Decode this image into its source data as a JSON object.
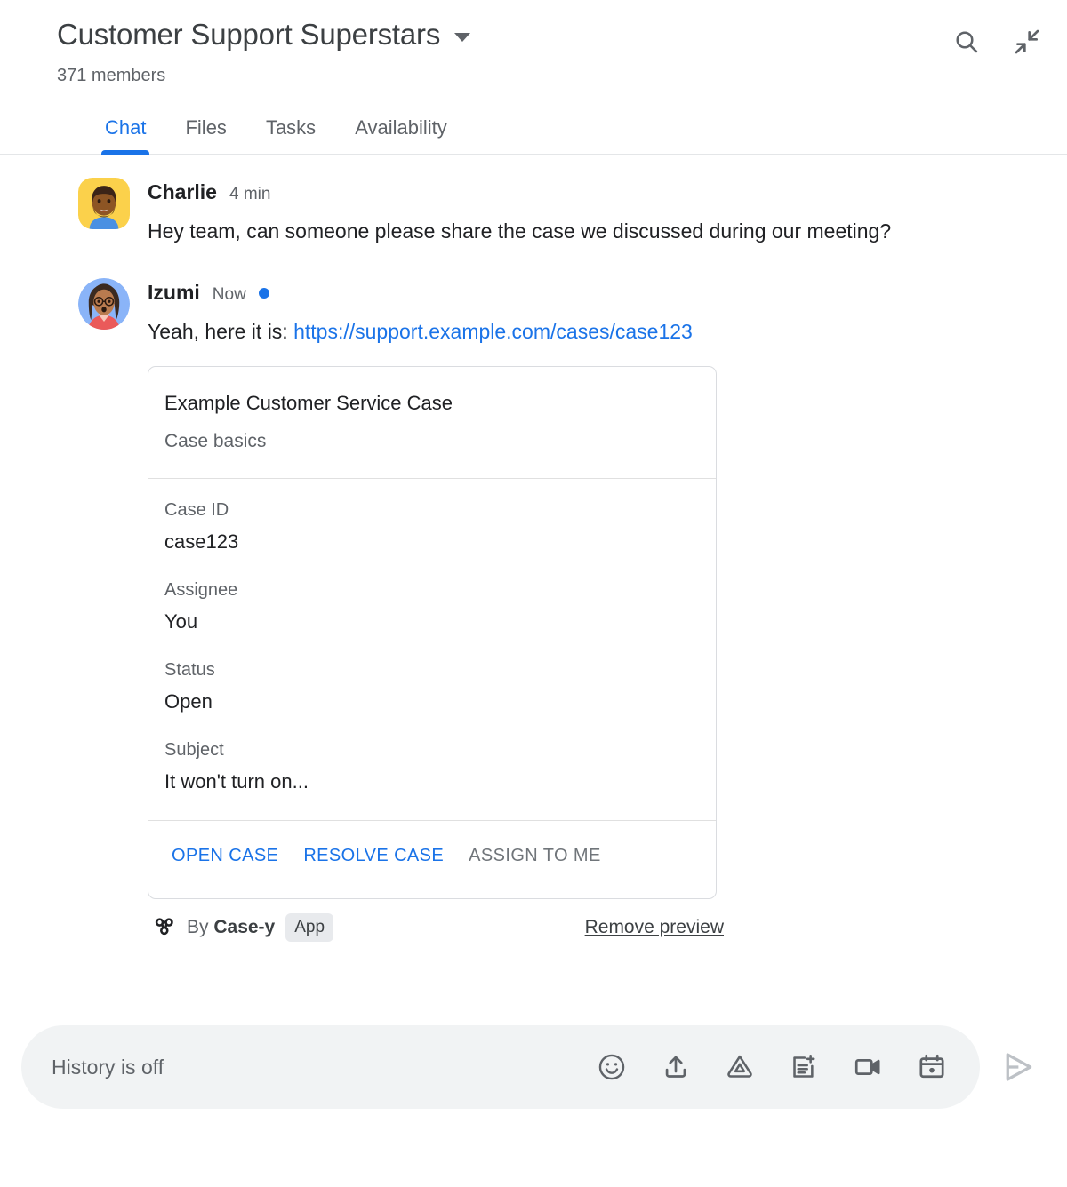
{
  "header": {
    "room_title": "Customer Support Superstars",
    "members": "371 members",
    "dropdown_icon": "chevron-down-icon",
    "search_icon": "search-icon",
    "collapse_icon": "collapse-icon"
  },
  "tabs": [
    {
      "label": "Chat",
      "active": true
    },
    {
      "label": "Files",
      "active": false
    },
    {
      "label": "Tasks",
      "active": false
    },
    {
      "label": "Availability",
      "active": false
    }
  ],
  "messages": [
    {
      "sender": "Charlie",
      "time": "4 min",
      "text": "Hey team, can someone please share the case we discussed during our meeting?",
      "avatar": "charlie-avatar"
    },
    {
      "sender": "Izumi",
      "time": "Now",
      "text_prefix": "Yeah, here it is: ",
      "link": "https://support.example.com/cases/case123",
      "avatar": "izumi-avatar"
    }
  ],
  "card": {
    "title": "Example Customer Service Case",
    "subtitle": "Case basics",
    "fields": [
      {
        "label": "Case ID",
        "value": "case123"
      },
      {
        "label": "Assignee",
        "value": "You"
      },
      {
        "label": "Status",
        "value": "Open"
      },
      {
        "label": "Subject",
        "value": "It won't turn on..."
      }
    ],
    "actions": [
      {
        "label": "OPEN CASE",
        "muted": false
      },
      {
        "label": "RESOLVE CASE",
        "muted": false
      },
      {
        "label": "ASSIGN TO ME",
        "muted": true
      }
    ],
    "footer": {
      "by_prefix": "By ",
      "app_name": "Case-y",
      "app_chip": "App",
      "remove_preview": "Remove preview",
      "bot_icon": "webhook-icon"
    }
  },
  "composer": {
    "placeholder": "History is off",
    "icons": [
      "emoji-icon",
      "upload-icon",
      "google-drive-icon",
      "create-doc-icon",
      "video-call-icon",
      "calendar-icon"
    ],
    "send_icon": "send-icon"
  },
  "colors": {
    "accent": "#1a73e8",
    "text_primary": "#202124",
    "text_secondary": "#5f6368",
    "composer_bg": "#f1f3f4",
    "border": "#dadce0"
  }
}
